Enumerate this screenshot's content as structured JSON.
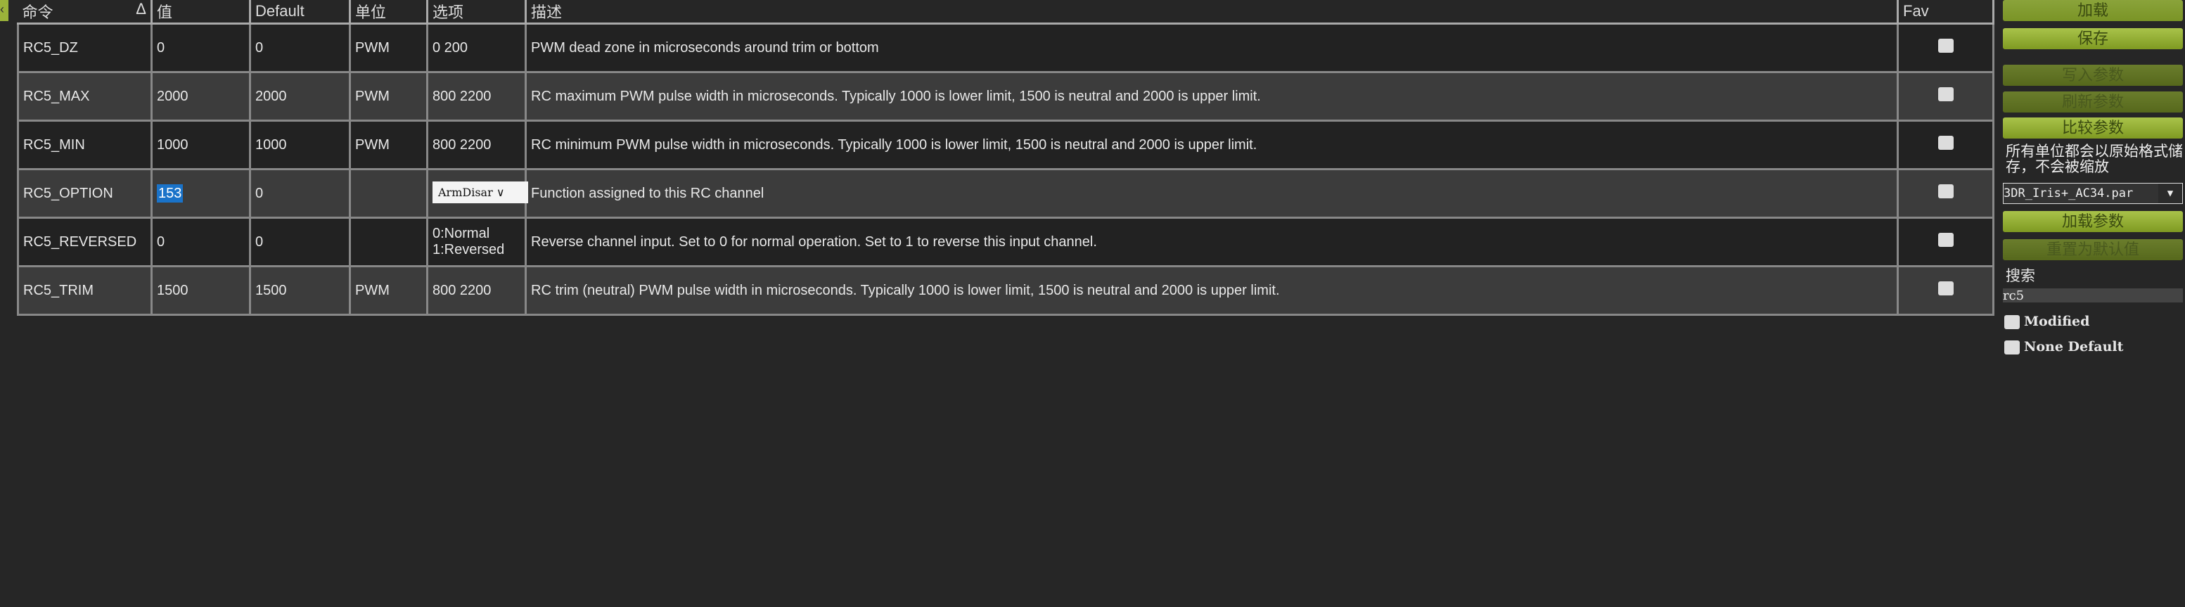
{
  "table": {
    "headers": [
      "命令",
      "值",
      "Default",
      "单位",
      "选项",
      "描述",
      "Fav"
    ],
    "sort_indicator": "Δ",
    "rows": [
      {
        "cmd": "RC5_DZ",
        "value": "0",
        "default": "0",
        "units": "PWM",
        "options": "0 200",
        "desc": "PWM dead zone in microseconds around trim or bottom"
      },
      {
        "cmd": "RC5_MAX",
        "value": "2000",
        "default": "2000",
        "units": "PWM",
        "options": "800 2200",
        "desc": "RC maximum PWM pulse width in microseconds. Typically 1000 is lower limit, 1500 is neutral and 2000 is upper limit."
      },
      {
        "cmd": "RC5_MIN",
        "value": "1000",
        "default": "1000",
        "units": "PWM",
        "options": "800 2200",
        "desc": "RC minimum PWM pulse width in microseconds. Typically 1000 is lower limit, 1500 is neutral and 2000 is upper limit."
      },
      {
        "cmd": "RC5_OPTION",
        "value": "153",
        "default": "0",
        "units": "",
        "options": "ArmDisar",
        "desc": "Function assigned to this RC channel"
      },
      {
        "cmd": "RC5_REVERSED",
        "value": "0",
        "default": "0",
        "units": "",
        "options": "0:Normal\n1:Reversed",
        "desc": "Reverse channel input. Set to 0 for normal operation. Set to 1 to reverse this input channel."
      },
      {
        "cmd": "RC5_TRIM",
        "value": "1500",
        "default": "1500",
        "units": "PWM",
        "options": "800 2200",
        "desc": "RC trim (neutral) PWM pulse width in microseconds. Typically 1000 is lower limit, 1500 is neutral and 2000 is upper limit."
      }
    ]
  },
  "panel": {
    "load": "加载",
    "save": "保存",
    "write": "写入参数",
    "refresh": "刷新参数",
    "compare": "比较参数",
    "note": "所有单位都会以原始格式储存，不会被缩放",
    "file": "3DR_Iris+_AC34.par",
    "load_params": "加载参数",
    "reset_default": "重置为默认值",
    "search_label": "搜索",
    "search_value": "rc5",
    "modified": "Modified",
    "none_default": "None Default"
  }
}
